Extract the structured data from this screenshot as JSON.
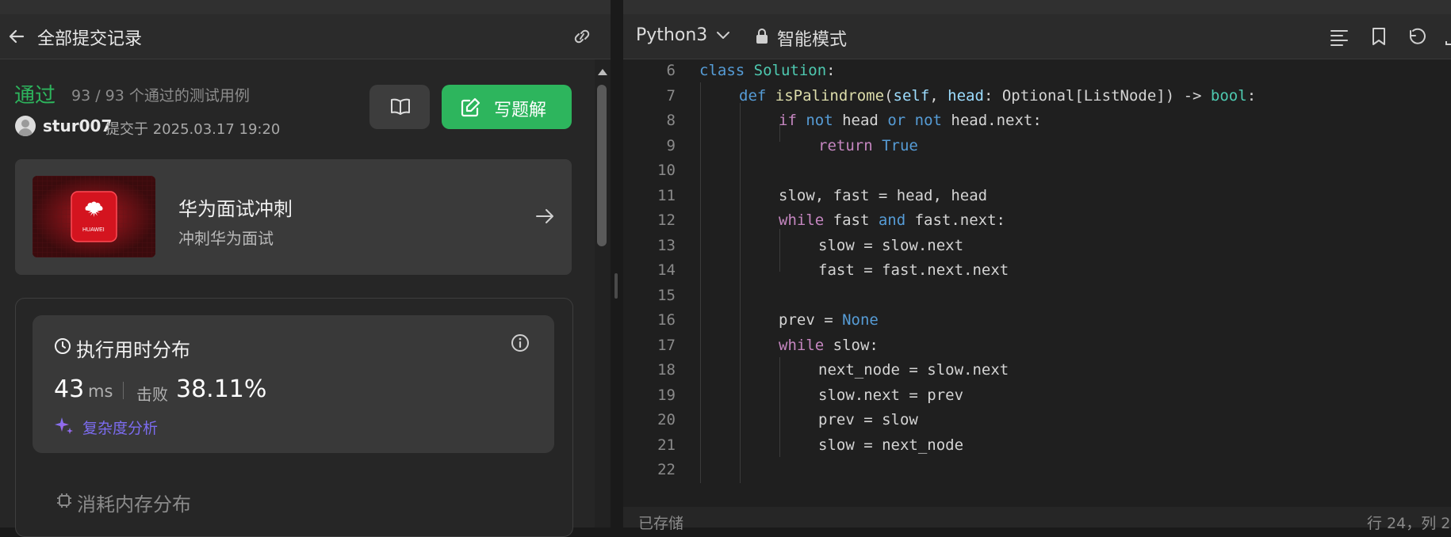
{
  "left_panel": {
    "header": {
      "back_icon": "arrow-left-icon",
      "title": "全部提交记录",
      "link_icon": "link-icon"
    },
    "submission": {
      "status": "通过",
      "cases": "93 / 93 个通过的测试用例",
      "username": "stur007",
      "submitted_at": "提交于 2025.03.17 19:20",
      "book_icon": "book-open-icon",
      "write_solution_label": "写题解",
      "write_icon": "edit-icon"
    },
    "promo": {
      "title": "华为面试冲刺",
      "subtitle": "冲刺华为面试",
      "logo_text": "HUAWEI",
      "arrow_icon": "arrow-right-icon"
    },
    "runtime": {
      "title": "执行用时分布",
      "value": "43",
      "unit": "ms",
      "beat_label": "击败",
      "beat_value": "38.11%",
      "complexity_link": "复杂度分析",
      "info_icon": "info-icon",
      "clock_icon": "clock-icon",
      "sparkle_icon": "sparkle-icon"
    },
    "memory": {
      "title": "消耗内存分布",
      "chip_icon": "chip-icon"
    }
  },
  "right_panel": {
    "toolbar": {
      "language": "Python3",
      "mode": "智能模式",
      "icons": [
        "format-icon",
        "bookmark-icon",
        "undo-icon"
      ]
    },
    "code_lines": [
      {
        "n": "6"
      },
      {
        "n": "7"
      },
      {
        "n": "8"
      },
      {
        "n": "9"
      },
      {
        "n": "10"
      },
      {
        "n": "11"
      },
      {
        "n": "12"
      },
      {
        "n": "13"
      },
      {
        "n": "14"
      },
      {
        "n": "15"
      },
      {
        "n": "16"
      },
      {
        "n": "17"
      },
      {
        "n": "18"
      },
      {
        "n": "19"
      },
      {
        "n": "20"
      },
      {
        "n": "21"
      },
      {
        "n": "22"
      }
    ],
    "code": {
      "l6_class": "class",
      "l6_name": "Solution",
      "l6_rest": ":",
      "l7_def": "def",
      "l7_fn": "isPalindrome",
      "l7_p1": "(",
      "l7_self": "self",
      "l7_p2": ", ",
      "l7_head": "head",
      "l7_p3": ": Optional[ListNode]) -> ",
      "l7_bool": "bool",
      "l7_p4": ":",
      "l8_if": "if",
      "l8_not1": "not",
      "l8_a": " head ",
      "l8_or": "or",
      "l8_not2": "not",
      "l8_b": " head.next:",
      "l9_return": "return",
      "l9_true": "True",
      "l11": "slow, fast = head, head",
      "l12_while": "while",
      "l12_a": " fast ",
      "l12_and": "and",
      "l12_b": " fast.next:",
      "l13": "slow = slow.next",
      "l14": "fast = fast.next.next",
      "l16_a": "prev = ",
      "l16_none": "None",
      "l17_while": "while",
      "l17_b": " slow:",
      "l18": "next_node = slow.next",
      "l19": "slow.next = prev",
      "l20": "prev = slow",
      "l21": "slow = next_node"
    },
    "status_bar": {
      "saved": "已存储",
      "cursor": "行 24，列 2"
    }
  }
}
